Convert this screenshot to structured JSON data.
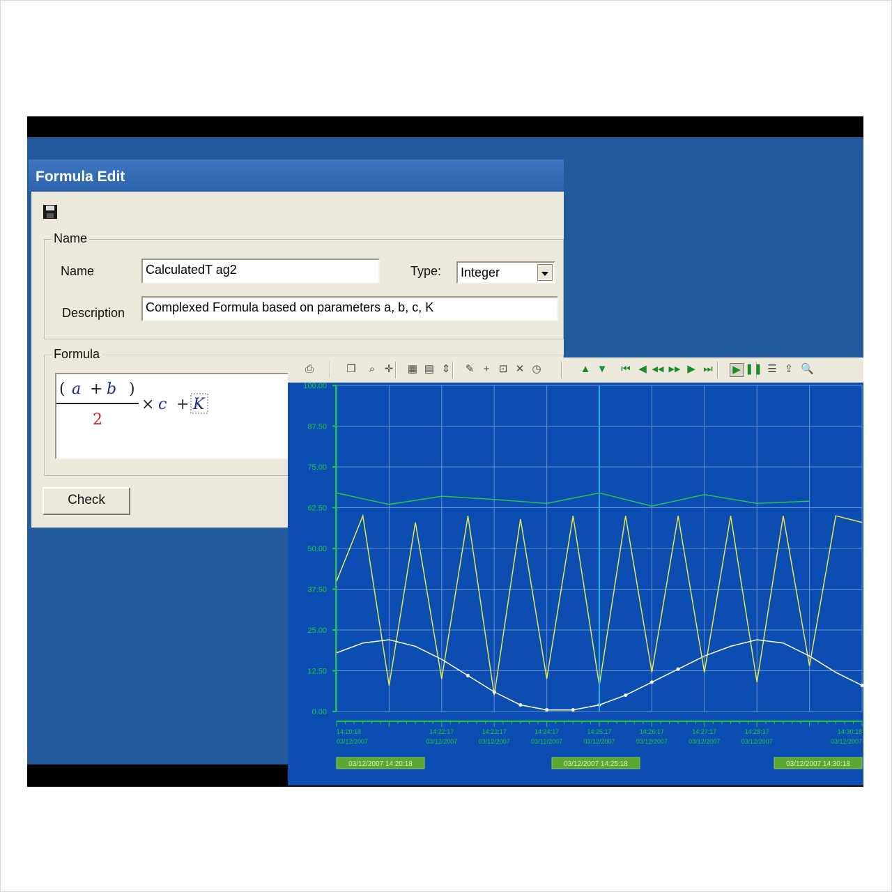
{
  "dialog": {
    "title": "Formula Edit",
    "name_group_label": "Name",
    "name_label": "Name",
    "name_value": "CalculatedT ag2",
    "type_label": "Type:",
    "type_value": "Integer",
    "description_label": "Description",
    "description_value": "Complexed Formula based on parameters a, b, c, K",
    "formula_group_label": "Formula",
    "formula": {
      "open_paren": "(",
      "a": "a",
      "plus1": "+",
      "b": "b",
      "close_paren": ")",
      "denominator": "2",
      "times": "×",
      "c": "c",
      "plus2": "+",
      "K": "K"
    },
    "check_label": "Check"
  },
  "trend": {
    "toolbar_icons": [
      "print-icon",
      "copy-icon",
      "zoom-icon",
      "crosshair-icon",
      "table-icon",
      "chart-icon",
      "scale-icon",
      "pen-icon",
      "cursor-icon",
      "zoom-box-icon",
      "delete-icon",
      "clock-icon",
      "up-icon",
      "down-icon",
      "first-icon",
      "prev-page-icon",
      "rewind-icon",
      "forward-icon",
      "next-page-icon",
      "last-icon",
      "play-icon",
      "pause-icon",
      "properties-icon",
      "export-icon",
      "search-icon"
    ],
    "colors": {
      "background": "#0b4db0",
      "grid": "#6a92d0",
      "axis": "#22c83c",
      "yellow": "#e4e84a",
      "green": "#30c050",
      "white": "#ffffff",
      "cursor": "#29b0d8"
    },
    "y_ticks": [
      "100.00",
      "87.50",
      "75.00",
      "62.50",
      "50.00",
      "37.50",
      "25.00",
      "12.50",
      "0.00"
    ],
    "x_ticks": [
      {
        "time": "14:20:18",
        "date": "03/12/2007"
      },
      {
        "time": "14:22:17",
        "date": "03/12/2007"
      },
      {
        "time": "14:23:17",
        "date": "03/12/2007"
      },
      {
        "time": "14:24:17",
        "date": "03/12/2007"
      },
      {
        "time": "14:25:17",
        "date": "03/12/2007"
      },
      {
        "time": "14:26:17",
        "date": "03/12/2007"
      },
      {
        "time": "14:27:17",
        "date": "03/12/2007"
      },
      {
        "time": "14:28:17",
        "date": "03/12/2007"
      },
      {
        "time": "14:30:18",
        "date": "03/12/2007"
      }
    ],
    "time_labels": [
      "03/12/2007 14:20:18",
      "03/12/2007 14:25:18",
      "03/12/2007 14:30:18"
    ]
  },
  "chart_data": {
    "type": "line",
    "xlim": [
      0,
      10
    ],
    "ylim": [
      0,
      100
    ],
    "cursor_x": 5,
    "series": [
      {
        "color": "#30c050",
        "x": [
          0,
          1,
          2,
          3,
          4,
          5,
          6,
          7,
          8,
          9
        ],
        "values": [
          67,
          63.5,
          66,
          65,
          63.8,
          67,
          63,
          66.5,
          63.8,
          64.5
        ]
      },
      {
        "color": "#e4e84a",
        "x": [
          0,
          0.5,
          1,
          1.5,
          2,
          2.5,
          3,
          3.5,
          4,
          4.5,
          5,
          5.5,
          6,
          6.5,
          7,
          7.5,
          8,
          8.5,
          9,
          9.5,
          10
        ],
        "values": [
          40,
          60,
          8,
          58,
          10,
          60,
          5,
          59,
          10,
          60,
          8,
          60,
          12,
          60,
          12,
          60,
          9,
          60,
          14,
          60,
          58
        ]
      },
      {
        "color": "#ffffff",
        "x": [
          0,
          0.5,
          1,
          1.5,
          2,
          2.5,
          3,
          3.5,
          4,
          4.5,
          5,
          5.5,
          6,
          6.5,
          7,
          7.5,
          8,
          8.5,
          9,
          9.5,
          10
        ],
        "values": [
          18,
          21,
          22,
          20,
          16,
          11,
          6,
          2,
          0.5,
          0.5,
          2,
          5,
          9,
          13,
          17,
          20,
          22,
          21,
          17,
          12,
          8
        ]
      }
    ]
  }
}
